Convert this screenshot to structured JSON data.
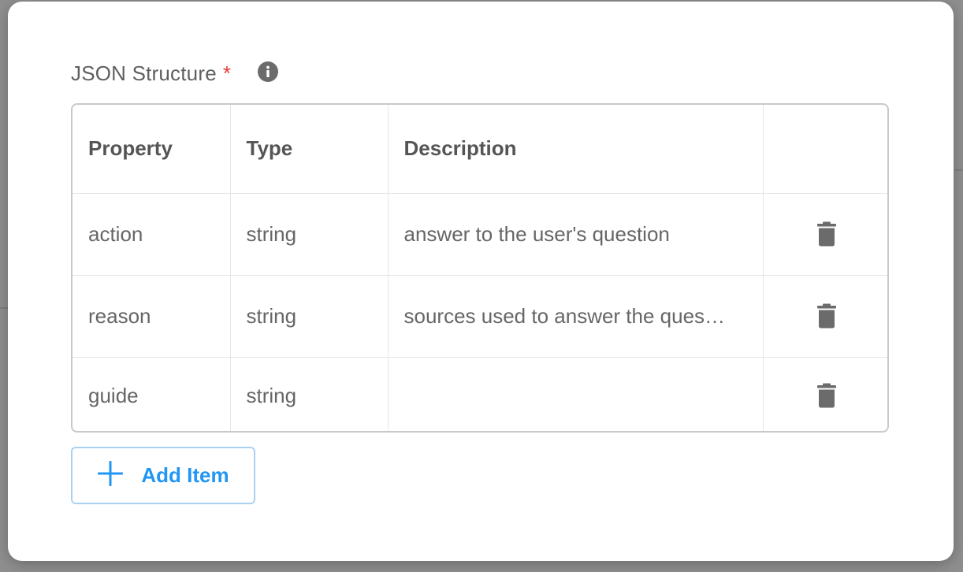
{
  "field": {
    "label": "JSON Structure",
    "required_marker": "*",
    "info_icon": "info-icon"
  },
  "table": {
    "columns": [
      "Property",
      "Type",
      "Description",
      ""
    ],
    "rows": [
      {
        "property": "action",
        "type": "string",
        "description": "answer to the user's question",
        "delete_icon": "trash-icon"
      },
      {
        "property": "reason",
        "type": "string",
        "description": "sources used to answer the ques…",
        "delete_icon": "trash-icon"
      },
      {
        "property": "guide",
        "type": "string",
        "description": "",
        "delete_icon": "trash-icon"
      }
    ]
  },
  "add_button": {
    "label": "Add Item",
    "icon": "plus-icon"
  },
  "colors": {
    "accent": "#2196f3",
    "required": "#e53935",
    "text": "#666666",
    "icon": "#6b6b6b"
  }
}
